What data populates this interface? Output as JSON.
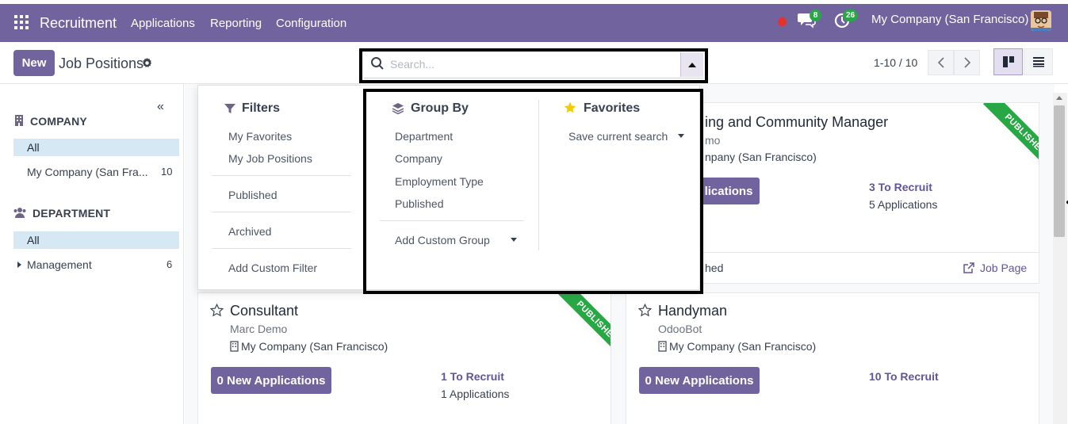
{
  "navbar": {
    "app_name": "Recruitment",
    "menu": [
      "Applications",
      "Reporting",
      "Configuration"
    ],
    "messages_badge": "8",
    "activities_badge": "26",
    "company": "My Company (San Francisco)"
  },
  "control_panel": {
    "new_button": "New",
    "title": "Job Positions",
    "search_placeholder": "Search...",
    "pager": "1-10 / 10"
  },
  "sidebar": {
    "company_heading": "COMPANY",
    "company_all": "All",
    "company_items": [
      {
        "label": "My Company (San Fra...",
        "count": "10"
      }
    ],
    "department_heading": "DEPARTMENT",
    "department_all": "All",
    "department_items": [
      {
        "label": "Management",
        "count": "6"
      }
    ]
  },
  "cards": [
    {
      "title": "ing and Community Manager",
      "subtitle": "mo",
      "company": "npany (San Francisco)",
      "button": "lications",
      "to_recruit": "3 To Recruit",
      "applications": "5 Applications",
      "ribbon": "PUBLISHED",
      "footer_left": "hed",
      "footer_link": "Job Page"
    },
    {
      "title": "Consultant",
      "subtitle": "Marc Demo",
      "company": "My Company (San Francisco)",
      "button": "0 New Applications",
      "to_recruit": "1 To Recruit",
      "applications": "1 Applications",
      "ribbon": "PUBLISHED"
    },
    {
      "title": "Handyman",
      "subtitle": "OdooBot",
      "company": "My Company (San Francisco)",
      "button": "0 New Applications",
      "to_recruit": "10 To Recruit"
    }
  ],
  "dropdown": {
    "filters": {
      "heading": "Filters",
      "items": [
        "My Favorites",
        "My Job Positions",
        "Published",
        "Archived",
        "Add Custom Filter"
      ]
    },
    "group_by": {
      "heading": "Group By",
      "items": [
        "Department",
        "Company",
        "Employment Type",
        "Published"
      ],
      "custom": "Add Custom Group"
    },
    "favorites": {
      "heading": "Favorites",
      "save": "Save current search"
    }
  },
  "colors": {
    "brand": "#71639e",
    "published_ribbon": "#28a745",
    "link": "#5f569b",
    "selected_bg": "#d7e8f5"
  }
}
